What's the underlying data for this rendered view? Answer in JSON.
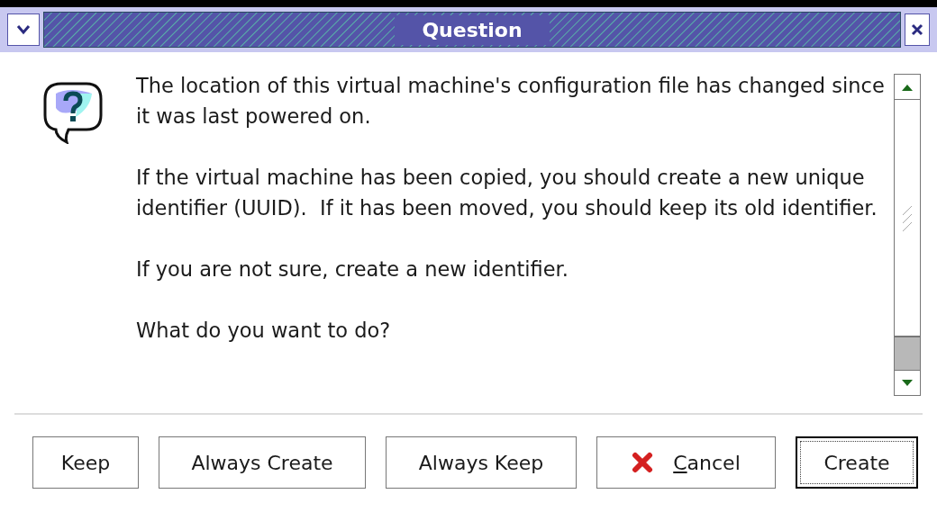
{
  "window": {
    "title": "Question"
  },
  "message": [
    "The location of this virtual machine's configuration file has changed since it was last powered on.",
    "If the virtual machine has been copied, you should create a new unique identifier (UUID).  If it has been moved, you should keep its old identifier.",
    "If you are not sure, create a new identifier.",
    "What do you want to do?"
  ],
  "buttons": [
    {
      "label": "Keep",
      "kind": "plain",
      "default": false
    },
    {
      "label": "Always Create",
      "kind": "plain",
      "default": false
    },
    {
      "label": "Always Keep",
      "kind": "plain",
      "default": false
    },
    {
      "mnemonic": "C",
      "label": "ancel",
      "kind": "cancel",
      "default": false
    },
    {
      "label": "Create",
      "kind": "plain",
      "default": true
    }
  ]
}
